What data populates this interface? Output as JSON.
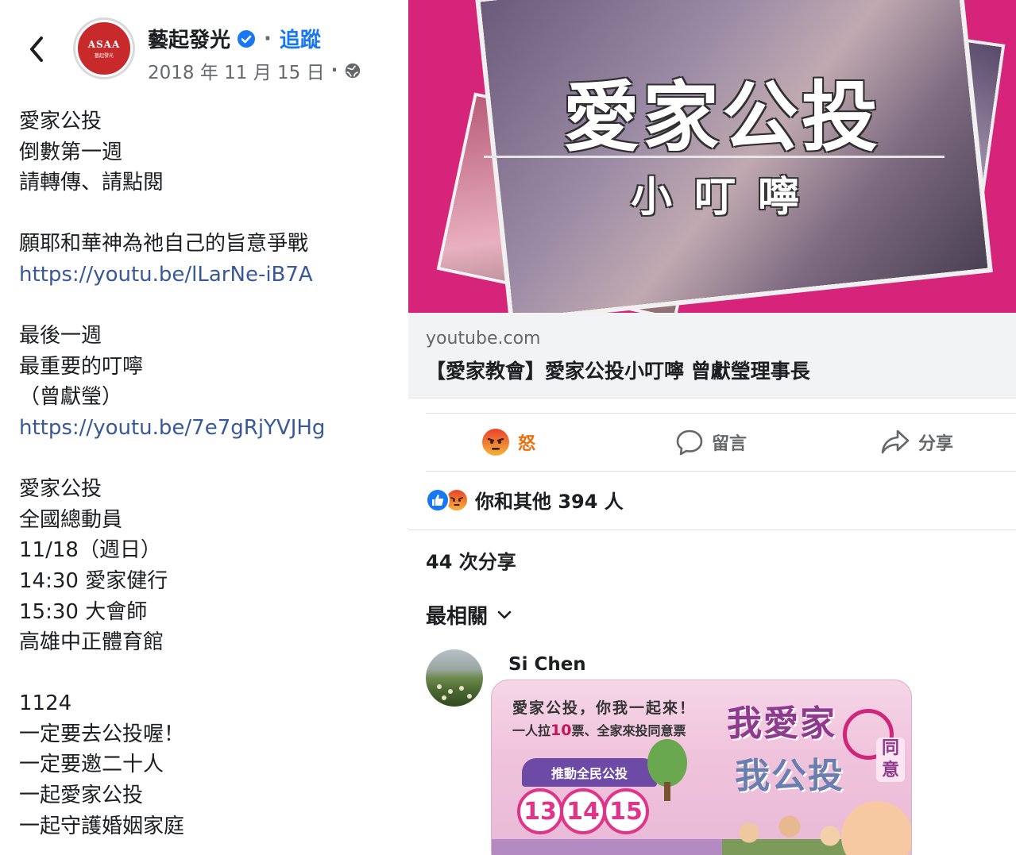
{
  "header": {
    "page_name": "藝起發光",
    "follow_label": "追蹤",
    "date": "2018 年 11 月 15 日",
    "avatar_text": "ASAA",
    "avatar_subtext": "藝起發光"
  },
  "post": {
    "lines": [
      {
        "text": "愛家公投",
        "type": "text"
      },
      {
        "text": "倒數第一週",
        "type": "text"
      },
      {
        "text": "請轉傳、請點閱",
        "type": "text"
      },
      {
        "text": "",
        "type": "blank"
      },
      {
        "text": "願耶和華神為祂自己的旨意爭戰",
        "type": "text"
      },
      {
        "text": "https://youtu.be/lLarNe-iB7A",
        "type": "link"
      },
      {
        "text": "",
        "type": "blank"
      },
      {
        "text": "最後一週",
        "type": "text"
      },
      {
        "text": "最重要的叮嚀",
        "type": "text"
      },
      {
        "text": "（曾獻瑩）",
        "type": "text"
      },
      {
        "text": "https://youtu.be/7e7gRjYVJHg",
        "type": "link"
      },
      {
        "text": "",
        "type": "blank"
      },
      {
        "text": "愛家公投",
        "type": "text"
      },
      {
        "text": "全國總動員",
        "type": "text"
      },
      {
        "text": "11/18（週日）",
        "type": "text"
      },
      {
        "text": "14:30 愛家健行",
        "type": "text"
      },
      {
        "text": "15:30 大會師",
        "type": "text"
      },
      {
        "text": "高雄中正體育館",
        "type": "text"
      },
      {
        "text": "",
        "type": "blank"
      },
      {
        "text": "1124",
        "type": "text"
      },
      {
        "text": "一定要去公投喔！",
        "type": "text"
      },
      {
        "text": "一定要邀二十人",
        "type": "text"
      },
      {
        "text": "一起愛家公投",
        "type": "text"
      },
      {
        "text": "一起守護婚姻家庭",
        "type": "text"
      }
    ]
  },
  "video": {
    "title_overlay": "愛家公投",
    "subtitle_overlay": "小叮嚀",
    "domain": "youtube.com",
    "link_title": "【愛家教會】愛家公投小叮嚀 曾獻瑩理事長"
  },
  "actions": {
    "angry_label": "怒",
    "comment_label": "留言",
    "share_label": "分享"
  },
  "reactions": {
    "summary": "你和其他 394 人",
    "shares": "44 次分享"
  },
  "comments": {
    "sort_label": "最相關",
    "first": {
      "author": "Si Chen",
      "image_line1": "愛家公投，你我一起來！",
      "image_line2_a": "一人拉",
      "image_line2_num": "10",
      "image_line2_b": "票、全家來投同意票",
      "image_badge": "推動全民公投",
      "image_numbers": [
        "13",
        "14",
        "15"
      ],
      "image_big1": "我愛家",
      "image_big2": "我公投",
      "image_side": "同意"
    }
  },
  "colors": {
    "facebook_blue": "#1877f2",
    "link_blue": "#385898",
    "angry_orange": "#e9710f",
    "thumbnail_pink": "#d5247a"
  }
}
